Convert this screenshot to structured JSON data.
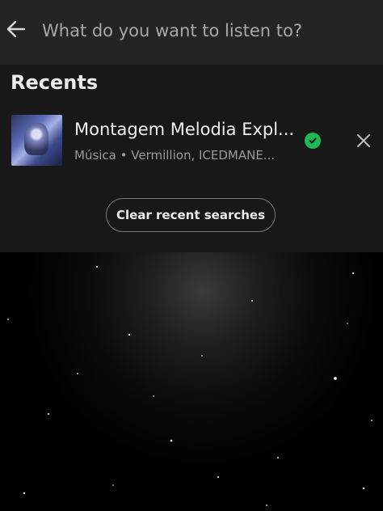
{
  "search": {
    "placeholder": "What do you want to listen to?",
    "back_icon": "arrow-left-icon"
  },
  "recents": {
    "title": "Recents",
    "items": [
      {
        "title": "Montagem Melodia Expl...",
        "subtitle": "Música • Vermillion, ICEDMANE...",
        "downloaded": true,
        "status_icon": "downloaded-check-icon",
        "remove_icon": "close-icon"
      }
    ],
    "clear_label": "Clear recent searches"
  },
  "colors": {
    "accent_green": "#1db954",
    "background": "#000000",
    "panel": "#181818",
    "topbar": "#242424"
  }
}
